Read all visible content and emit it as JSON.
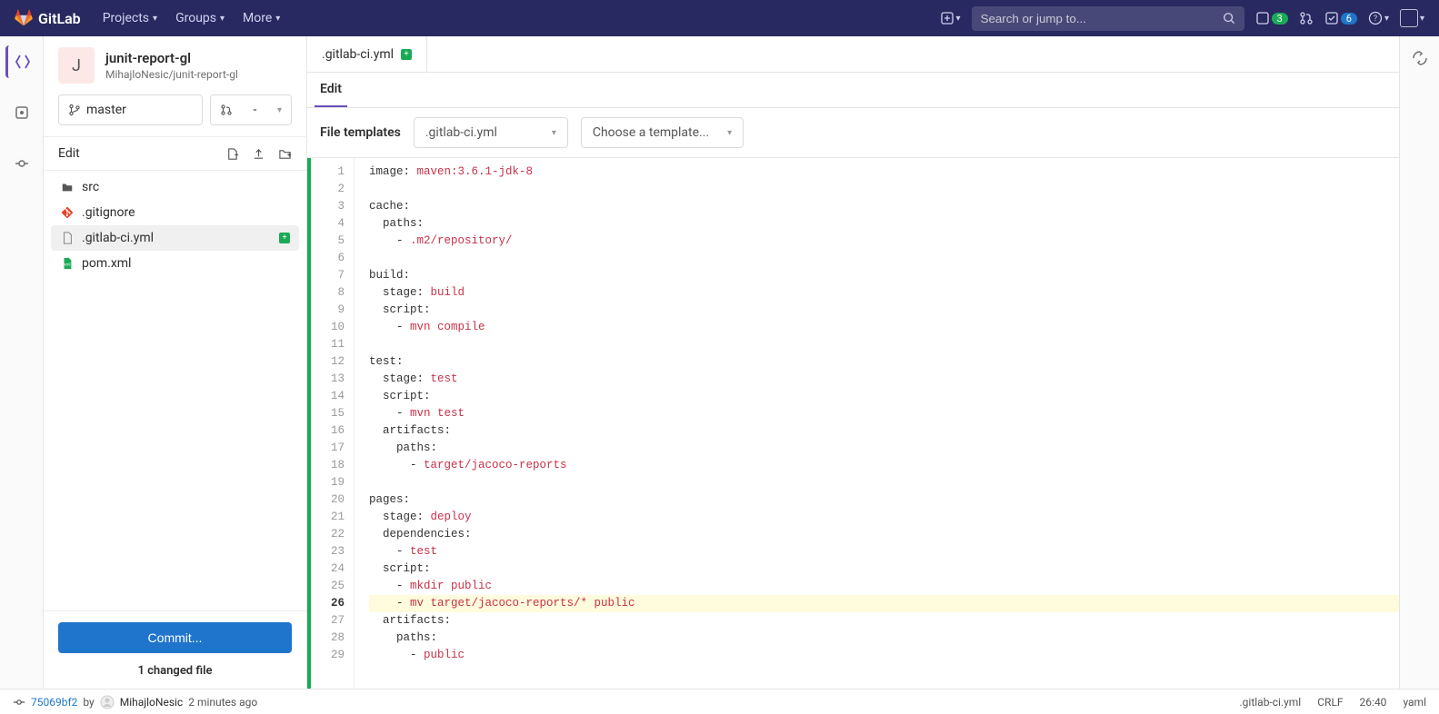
{
  "navbar": {
    "brand": "GitLab",
    "items": [
      "Projects",
      "Groups",
      "More"
    ],
    "search_placeholder": "Search or jump to...",
    "issues_count": "3",
    "todos_count": "6"
  },
  "project": {
    "avatar_letter": "J",
    "name": "junit-report-gl",
    "path": "MihajloNesic/junit-report-gl"
  },
  "branch": {
    "name": "master",
    "mr": "-"
  },
  "sidebar": {
    "section_label": "Edit",
    "tree": [
      {
        "icon": "folder",
        "name": "src",
        "status": "none"
      },
      {
        "icon": "git",
        "name": ".gitignore",
        "status": "none"
      },
      {
        "icon": "file",
        "name": ".gitlab-ci.yml",
        "status": "new",
        "active": true
      },
      {
        "icon": "xml",
        "name": "pom.xml",
        "status": "none"
      }
    ],
    "commit_label": "Commit...",
    "changed_label": "1 changed file"
  },
  "tabs": {
    "open_file": ".gitlab-ci.yml",
    "edit_label": "Edit"
  },
  "toolbar": {
    "templates_label": "File templates",
    "type_selected": ".gitlab-ci.yml",
    "template_placeholder": "Choose a template..."
  },
  "editor": {
    "current_line": 26,
    "lines": [
      {
        "segments": [
          [
            "key",
            "image"
          ],
          [
            "colon",
            ": "
          ],
          [
            "str",
            "maven:3.6.1-jdk-8"
          ]
        ]
      },
      {
        "segments": []
      },
      {
        "segments": [
          [
            "key",
            "cache"
          ],
          [
            "colon",
            ":"
          ]
        ]
      },
      {
        "segments": [
          [
            "key",
            "  paths"
          ],
          [
            "colon",
            ":"
          ]
        ]
      },
      {
        "segments": [
          [
            "key",
            "    - "
          ],
          [
            "str",
            ".m2/repository/"
          ]
        ]
      },
      {
        "segments": []
      },
      {
        "segments": [
          [
            "key",
            "build"
          ],
          [
            "colon",
            ":"
          ]
        ]
      },
      {
        "segments": [
          [
            "key",
            "  stage"
          ],
          [
            "colon",
            ": "
          ],
          [
            "str",
            "build"
          ]
        ]
      },
      {
        "segments": [
          [
            "key",
            "  script"
          ],
          [
            "colon",
            ":"
          ]
        ]
      },
      {
        "segments": [
          [
            "key",
            "    - "
          ],
          [
            "str",
            "mvn compile"
          ]
        ]
      },
      {
        "segments": []
      },
      {
        "segments": [
          [
            "key",
            "test"
          ],
          [
            "colon",
            ":"
          ]
        ]
      },
      {
        "segments": [
          [
            "key",
            "  stage"
          ],
          [
            "colon",
            ": "
          ],
          [
            "str",
            "test"
          ]
        ]
      },
      {
        "segments": [
          [
            "key",
            "  script"
          ],
          [
            "colon",
            ":"
          ]
        ]
      },
      {
        "segments": [
          [
            "key",
            "    - "
          ],
          [
            "str",
            "mvn test"
          ]
        ]
      },
      {
        "segments": [
          [
            "key",
            "  artifacts"
          ],
          [
            "colon",
            ":"
          ]
        ]
      },
      {
        "segments": [
          [
            "key",
            "    paths"
          ],
          [
            "colon",
            ":"
          ]
        ]
      },
      {
        "segments": [
          [
            "key",
            "      - "
          ],
          [
            "str",
            "target/jacoco-reports"
          ]
        ]
      },
      {
        "segments": []
      },
      {
        "segments": [
          [
            "key",
            "pages"
          ],
          [
            "colon",
            ":"
          ]
        ]
      },
      {
        "segments": [
          [
            "key",
            "  stage"
          ],
          [
            "colon",
            ": "
          ],
          [
            "str",
            "deploy"
          ]
        ]
      },
      {
        "segments": [
          [
            "key",
            "  dependencies"
          ],
          [
            "colon",
            ":"
          ]
        ]
      },
      {
        "segments": [
          [
            "key",
            "    - "
          ],
          [
            "str",
            "test"
          ]
        ]
      },
      {
        "segments": [
          [
            "key",
            "  script"
          ],
          [
            "colon",
            ":"
          ]
        ]
      },
      {
        "segments": [
          [
            "key",
            "    - "
          ],
          [
            "str",
            "mkdir public"
          ]
        ]
      },
      {
        "segments": [
          [
            "key",
            "    - "
          ],
          [
            "str",
            "mv target/jacoco-reports/* public"
          ]
        ]
      },
      {
        "segments": [
          [
            "key",
            "  artifacts"
          ],
          [
            "colon",
            ":"
          ]
        ]
      },
      {
        "segments": [
          [
            "key",
            "    paths"
          ],
          [
            "colon",
            ":"
          ]
        ]
      },
      {
        "segments": [
          [
            "key",
            "      - "
          ],
          [
            "str",
            "public"
          ]
        ]
      }
    ]
  },
  "status": {
    "sha": "75069bf2",
    "by": "by",
    "author": "MihajloNesic",
    "time": "2 minutes ago",
    "file": ".gitlab-ci.yml",
    "eol": "CRLF",
    "cursor": "26:40",
    "lang": "yaml"
  }
}
